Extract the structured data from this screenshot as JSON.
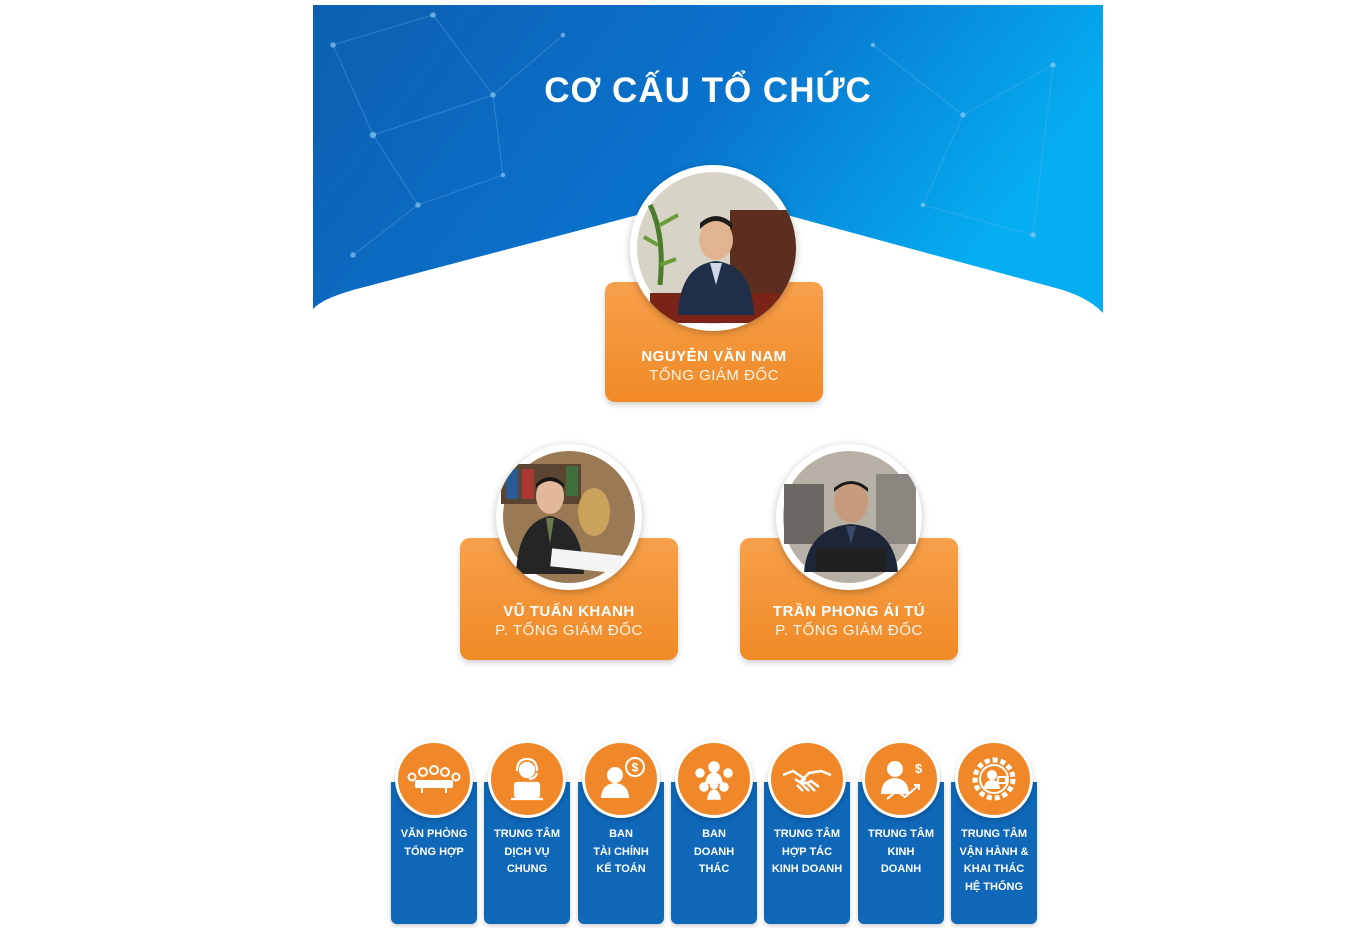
{
  "title": "CƠ CẤU TỔ CHỨC",
  "colors": {
    "hero_start": "#0c5fb0",
    "hero_end": "#05aef0",
    "card": "#f39434",
    "dept": "#0f67b8"
  },
  "leaders": [
    {
      "name": "NGUYỄN VĂN NAM",
      "role": "TỔNG GIÁM ĐỐC"
    },
    {
      "name": "VŨ TUẤN KHANH",
      "role": "P. TỔNG GIÁM ĐỐC"
    },
    {
      "name": "TRẦN PHONG ÁI TÚ",
      "role": "P. TỔNG GIÁM ĐỐC"
    }
  ],
  "departments": [
    {
      "label": "VĂN PHÒNG\nTỔNG HỢP",
      "icon": "meeting-table-icon"
    },
    {
      "label": "TRUNG TÂM\nDỊCH VỤ\nCHUNG",
      "icon": "support-headset-icon"
    },
    {
      "label": "BAN\nTÀI CHÍNH\nKẾ TOÁN",
      "icon": "finance-person-icon"
    },
    {
      "label": "BAN\nDOANH\nTHÁC",
      "icon": "group-people-icon"
    },
    {
      "label": "TRUNG TÂM\nHỢP TÁC\nKINH DOANH",
      "icon": "handshake-icon"
    },
    {
      "label": "TRUNG TÂM\nKINH\nDOANH",
      "icon": "sales-growth-icon"
    },
    {
      "label": "TRUNG TÂM\nVẬN HÀNH &\nKHAI THÁC\nHỆ THỐNG",
      "icon": "gear-operations-icon"
    }
  ]
}
